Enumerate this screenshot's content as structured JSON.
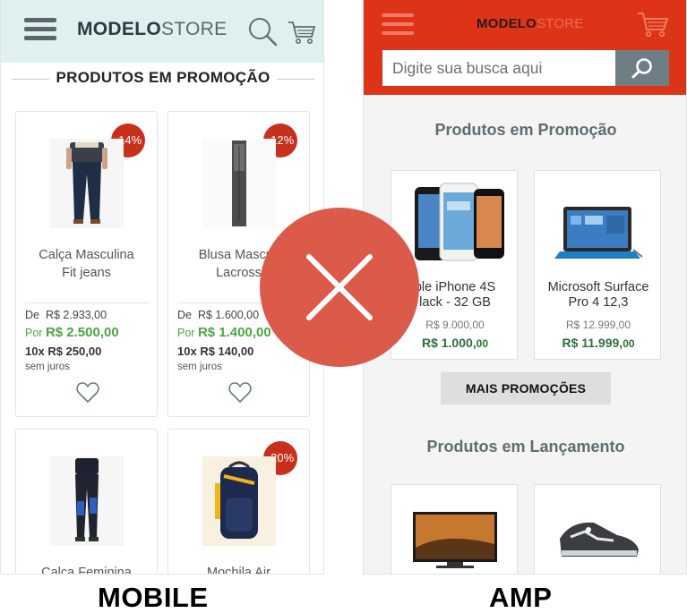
{
  "mobile": {
    "label": "MOBILE",
    "logo_bold": "MODELO",
    "logo_light": "STORE",
    "section_title": "PRODUTOS EM PROMOÇÃO",
    "products": [
      {
        "badge": "-14%",
        "name_line1": "Calça Masculina",
        "name_line2": "Fit jeans",
        "old_prefix": "De",
        "old_price": "R$ 2.933,00",
        "new_prefix": "Por",
        "new_price": "R$ 2.500,00",
        "install_count": "10x",
        "install_value": "R$ 250,00",
        "install_note": "sem juros",
        "image_icon": "jeans-image"
      },
      {
        "badge": "-12%",
        "name_line1": "Blusa Masculi",
        "name_line2": "Lacross",
        "old_prefix": "De",
        "old_price": "R$ 1.600,00",
        "new_prefix": "Por",
        "new_price": "R$ 1.400,00",
        "install_count": "10x",
        "install_value": "R$ 140,00",
        "install_note": "sem juros",
        "image_icon": "shirt-image"
      },
      {
        "badge": "",
        "name_line1": "Calça Feminina",
        "image_icon": "leggings-image"
      },
      {
        "badge": "-20%",
        "name_line1": "Mochila Air",
        "image_icon": "backpack-image"
      }
    ]
  },
  "amp": {
    "label": "AMP",
    "logo_bold": "MODELO",
    "logo_light": "STORE",
    "search_placeholder": "Digite sua busca aqui",
    "promo_title": "Produtos em Promoção",
    "launch_title": "Produtos em Lançamento",
    "more_button": "MAIS PROMOÇÕES",
    "products": [
      {
        "name_line1": "ple iPhone 4S",
        "name_line2": "lack - 32 GB",
        "old_price": "R$ 9.000,00",
        "new_price_int": "R$ 1.000,",
        "new_price_cents": "00",
        "image_icon": "iphone-image"
      },
      {
        "name_line1": "Microsoft Surface",
        "name_line2": "Pro 4 12,3",
        "old_price": "R$ 12.999,00",
        "new_price_int": "R$ 11.999,",
        "new_price_cents": "00",
        "image_icon": "tablet-image"
      }
    ],
    "launch_products": [
      {
        "image_icon": "tv-image"
      },
      {
        "image_icon": "sneaker-image"
      }
    ]
  },
  "colors": {
    "mobile_header": "#dff0f0",
    "amp_header": "#dd3317",
    "badge": "#c9301c",
    "price_green": "#4aa640",
    "x_circle": "#dc5a4a"
  }
}
